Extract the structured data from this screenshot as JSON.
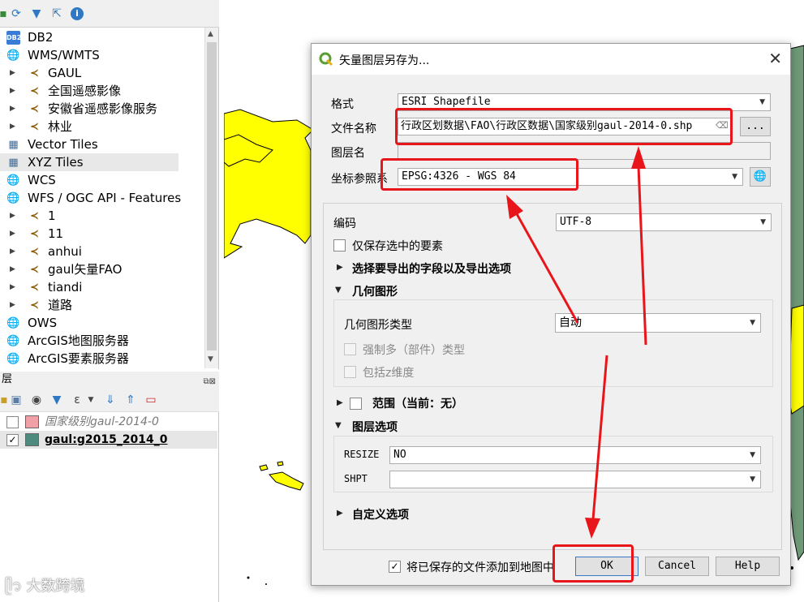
{
  "browser": {
    "items": [
      {
        "label": "DB2",
        "icon": "db2-icon"
      },
      {
        "label": "WMS/WMTS",
        "icon": "globe-icon"
      },
      {
        "label": "GAUL",
        "icon": "connection-icon"
      },
      {
        "label": "全国遥感影像",
        "icon": "connection-icon"
      },
      {
        "label": "安徽省遥感影像服务",
        "icon": "connection-icon"
      },
      {
        "label": "林业",
        "icon": "connection-icon"
      },
      {
        "label": "Vector Tiles",
        "icon": "grid-icon"
      },
      {
        "label": "XYZ Tiles",
        "icon": "grid-icon"
      },
      {
        "label": "WCS",
        "icon": "globe-icon"
      },
      {
        "label": "WFS / OGC API - Features",
        "icon": "wfs-icon"
      },
      {
        "label": "1",
        "icon": "connection-icon"
      },
      {
        "label": "11",
        "icon": "connection-icon"
      },
      {
        "label": "anhui",
        "icon": "connection-icon"
      },
      {
        "label": "gaul矢量FAO",
        "icon": "connection-icon"
      },
      {
        "label": "tiandi",
        "icon": "connection-icon"
      },
      {
        "label": "道路",
        "icon": "connection-icon"
      },
      {
        "label": "OWS",
        "icon": "globe-icon"
      },
      {
        "label": "ArcGIS地图服务器",
        "icon": "globe-icon"
      },
      {
        "label": "ArcGIS要素服务器",
        "icon": "globe-icon"
      }
    ]
  },
  "layers_panel": {
    "title": "层",
    "layers": [
      {
        "name": "国家级别gaul-2014-0",
        "checked": false,
        "color": "#f2a0a8"
      },
      {
        "name": "gaul:g2015_2014_0",
        "checked": true,
        "color": "#4e8a7e"
      }
    ]
  },
  "dialog": {
    "title": "矢量图层另存为...",
    "format_label": "格式",
    "format_value": "ESRI Shapefile",
    "filename_label": "文件名称",
    "filename_value": "行政区划数据\\FAO\\行政区数据\\国家级别gaul-2014-0.shp",
    "browse_label": "...",
    "layername_label": "图层名",
    "crs_label": "坐标参照系",
    "crs_value": "EPSG:4326 - WGS 84",
    "encoding_label": "编码",
    "encoding_value": "UTF-8",
    "selected_only_label": "仅保存选中的要素",
    "fields_section": "选择要导出的字段以及导出选项",
    "geometry_section": "几何图形",
    "geometry_type_label": "几何图形类型",
    "geometry_type_value": "自动",
    "force_multi_label": "强制多（部件）类型",
    "include_z_label": "包括z维度",
    "extent_section": "范围（当前：无）",
    "layer_options_section": "图层选项",
    "resize_label": "RESIZE",
    "resize_value": "NO",
    "shpt_label": "SHPT",
    "shpt_value": "",
    "custom_section": "自定义选项",
    "add_to_map_label": "将已保存的文件添加到地图中",
    "ok_label": "OK",
    "cancel_label": "Cancel",
    "help_label": "Help"
  },
  "watermark": "大数跨境",
  "colors": {
    "highlight_red": "#e8161a",
    "map_land_yellow": "#ffff00",
    "map_land_green": "#6f9a78"
  }
}
